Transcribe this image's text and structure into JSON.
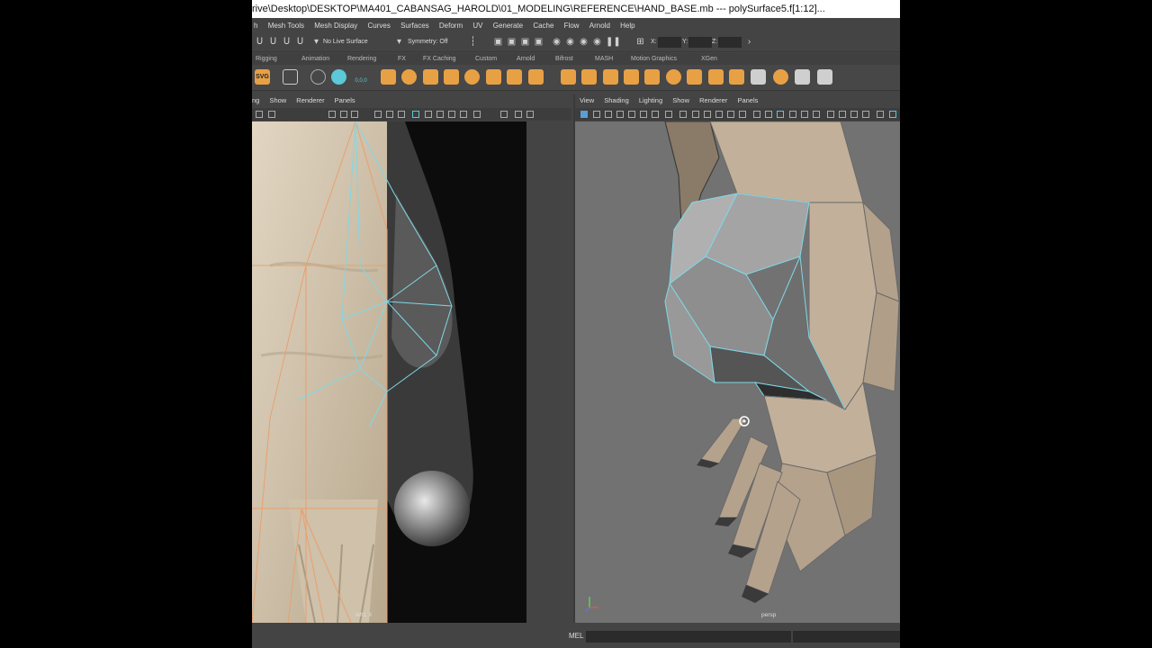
{
  "window": {
    "title": "rive\\Desktop\\DESKTOP\\MA401_CABANSAG_HAROLD\\01_MODELING\\REFERENCE\\HAND_BASE.mb  ---  polySurface5.f[1:12]..."
  },
  "menubar": {
    "items": [
      "h",
      "Mesh Tools",
      "Mesh Display",
      "Curves",
      "Surfaces",
      "Deform",
      "UV",
      "Generate",
      "Cache",
      "Flow",
      "Arnold",
      "Help"
    ]
  },
  "statusline": {
    "live_surface": "No Live Surface",
    "symmetry": "Symmetry: Off",
    "x_label": "X:",
    "y_label": "Y:",
    "z_label": "Z:"
  },
  "shelf_tabs": [
    "Rigging",
    "Animation",
    "Rendering",
    "FX",
    "FX Caching",
    "Custom",
    "Arnold",
    "Bifrost",
    "MASH",
    "Motion Graphics",
    "XGen"
  ],
  "shelf": {
    "svg_label": "SVG",
    "coord_label": "0,0,0"
  },
  "left_panel": {
    "menus": [
      "ng",
      "Show",
      "Renderer",
      "Panels"
    ],
    "camera_label": "left1 X"
  },
  "right_panel": {
    "menus": [
      "View",
      "Shading",
      "Lighting",
      "Show",
      "Renderer",
      "Panels"
    ],
    "camera_label": "persp"
  },
  "cmdline": {
    "label": "MEL"
  },
  "colors": {
    "accent": "#e8a045",
    "wire_selected": "#7fd8e8",
    "wire_orange": "#e8a070",
    "background": "#444444"
  }
}
